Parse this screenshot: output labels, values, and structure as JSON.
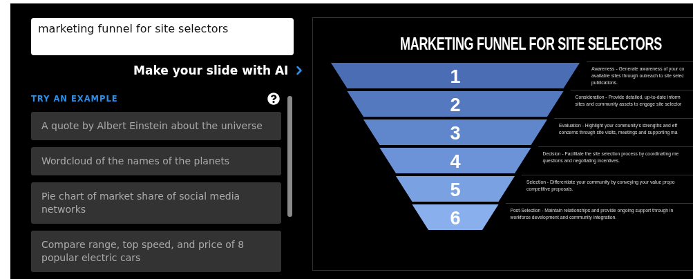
{
  "prompt": {
    "value": "marketing funnel for site selectors"
  },
  "make_button": {
    "label": "Make your slide with AI"
  },
  "examples": {
    "heading": "TRY AN EXAMPLE",
    "items": [
      {
        "text": "A quote by Albert Einstein about the universe"
      },
      {
        "text": "Wordcloud of the names of the planets"
      },
      {
        "text": "Pie chart of market share of social media networks"
      },
      {
        "text": "Compare range, top speed, and price of 8 popular electric cars"
      }
    ]
  },
  "slide": {
    "title": "MARKETING FUNNEL FOR SITE SELECTORS",
    "stages": [
      {
        "number": "1",
        "color": "#4a6db3",
        "lines": [
          "Awareness - Generate awareness of your co",
          "available sites through outreach to site selec",
          "publications."
        ]
      },
      {
        "number": "2",
        "color": "#5579bf",
        "lines": [
          "Consideration - Provide detailed, up-to-date inform",
          "sites and community assets to engage site selector"
        ]
      },
      {
        "number": "3",
        "color": "#6086cb",
        "lines": [
          "Evaluation - Highlight your community's strengths and eff",
          "concerns through site visits, meetings and supporting ma"
        ]
      },
      {
        "number": "4",
        "color": "#6c93d7",
        "lines": [
          "Decision - Facilitate the site selection process by coordinating me",
          "questions and negotiating incentives."
        ]
      },
      {
        "number": "5",
        "color": "#7aa1e2",
        "lines": [
          "Selection - Differentiate your community by conveying your value propo",
          "competitive proposals."
        ]
      },
      {
        "number": "6",
        "color": "#89afec",
        "lines": [
          "Post-Selection - Maintain relationships and provide ongoing support through in",
          "workforce development and community integration."
        ]
      }
    ]
  }
}
